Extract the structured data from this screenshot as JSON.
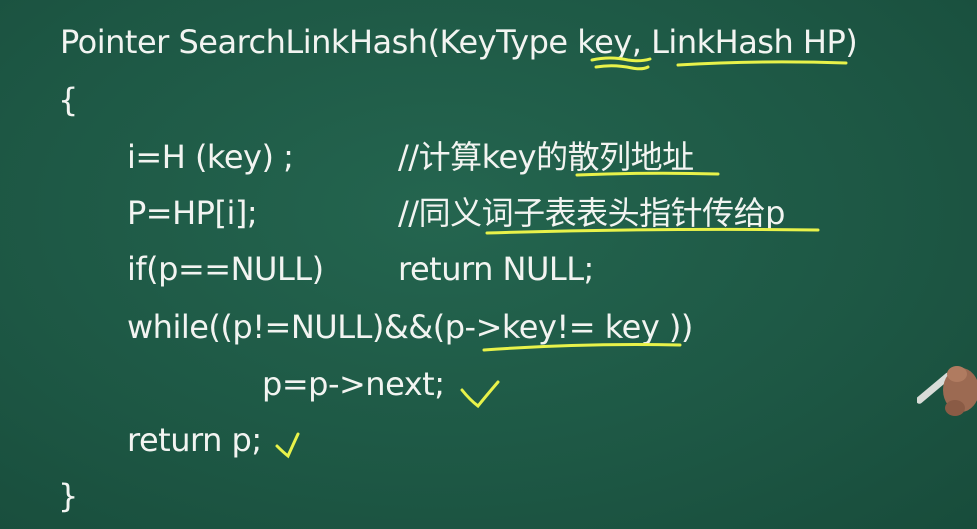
{
  "code": {
    "signature": "Pointer SearchLinkHash(KeyType key, LinkHash HP)",
    "open_brace": "{",
    "line1_stmt": "i=H (key) ;",
    "line1_comment": "//计算key的散列地址",
    "line2_stmt": "P=HP[i];",
    "line2_comment": "//同义词子表表头指针传给p",
    "line3_stmt": "if(p==NULL)",
    "line3_action": "return NULL;",
    "line4_stmt": "while((p!=NULL)&&(p->key!= key ))",
    "line5_stmt": "p=p->next;",
    "line6_stmt": "return p;",
    "close_brace": "}"
  },
  "colors": {
    "background": "#1f5a47",
    "chalk_text": "#f2f4f1",
    "highlight": "#e8f24a"
  },
  "icons": {
    "check_marks": "check-icon",
    "hand": "hand-icon"
  }
}
